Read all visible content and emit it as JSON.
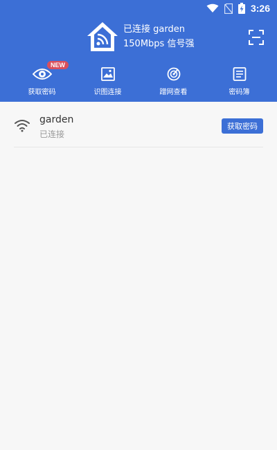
{
  "statusbar": {
    "time": "3:26"
  },
  "connection": {
    "line1": "已连接 garden",
    "line2": "150Mbps 信号强"
  },
  "tabs": [
    {
      "label": "获取密码",
      "icon": "eye-icon",
      "badge": "NEW"
    },
    {
      "label": "识图连接",
      "icon": "image-icon"
    },
    {
      "label": "蹭网查看",
      "icon": "radar-icon"
    },
    {
      "label": "密码簿",
      "icon": "notebook-icon"
    }
  ],
  "networks": [
    {
      "name": "garden",
      "status": "已连接",
      "action": "获取密码"
    }
  ],
  "colors": {
    "accent": "#3c6fd6",
    "badge": "#d94f5c"
  }
}
